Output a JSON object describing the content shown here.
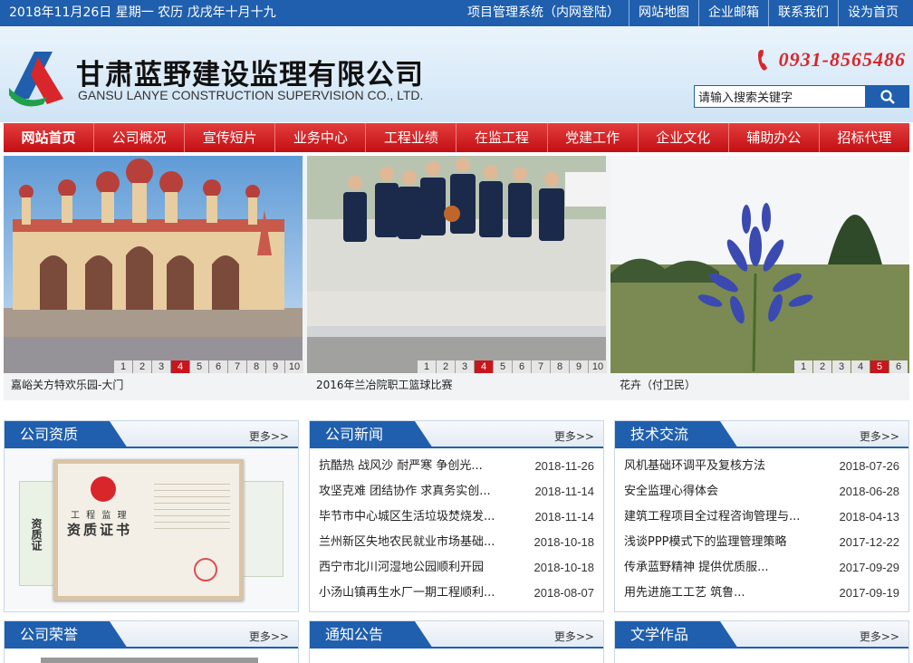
{
  "topbar": {
    "date": "2018年11月26日 星期一 农历 戊戌年十月十九",
    "links": [
      "项目管理系统（内网登陆）",
      "网站地图",
      "企业邮箱",
      "联系我们",
      "设为首页"
    ]
  },
  "header": {
    "company_name": "甘肃蓝野建设监理有限公司",
    "company_name_en": "GANSU LANYE CONSTRUCTION SUPERVISION CO., LTD.",
    "phone": "0931-8565486"
  },
  "search": {
    "placeholder": "请输入搜索关键字",
    "value": "请输入搜索关键字"
  },
  "nav": [
    "网站首页",
    "公司概况",
    "宣传短片",
    "业务中心",
    "工程业绩",
    "在监工程",
    "党建工作",
    "企业文化",
    "辅助办公",
    "招标代理"
  ],
  "slides": [
    {
      "caption": "嘉峪关方特欢乐园-大门",
      "pages": [
        "1",
        "2",
        "3",
        "4",
        "5",
        "6",
        "7",
        "8",
        "9",
        "10"
      ],
      "active": "4"
    },
    {
      "caption": "2016年兰冶院职工篮球比赛",
      "pages": [
        "1",
        "2",
        "3",
        "4",
        "5",
        "6",
        "7",
        "8",
        "9",
        "10"
      ],
      "active": "4"
    },
    {
      "caption": "花卉（付卫民）",
      "pages": [
        "1",
        "2",
        "3",
        "4",
        "5",
        "6"
      ],
      "active": "5"
    }
  ],
  "sections": {
    "qualification": {
      "title": "公司资质",
      "more": "更多>>"
    },
    "news": {
      "title": "公司新闻",
      "more": "更多>>",
      "items": [
        {
          "title": "抗酷热 战风沙 耐严寒 争创光...",
          "date": "2018-11-26"
        },
        {
          "title": "攻坚克难 团结协作 求真务实创...",
          "date": "2018-11-14"
        },
        {
          "title": "毕节市中心城区生活垃圾焚烧发...",
          "date": "2018-11-14"
        },
        {
          "title": "兰州新区失地农民就业市场基础...",
          "date": "2018-10-18"
        },
        {
          "title": "西宁市北川河湿地公园顺利开园",
          "date": "2018-10-18"
        },
        {
          "title": "小汤山镇再生水厂一期工程顺利...",
          "date": "2018-08-07"
        }
      ]
    },
    "tech": {
      "title": "技术交流",
      "more": "更多>>",
      "items": [
        {
          "title": "风机基础环调平及复核方法",
          "date": "2018-07-26"
        },
        {
          "title": "安全监理心得体会",
          "date": "2018-06-28"
        },
        {
          "title": "建筑工程项目全过程咨询管理与...",
          "date": "2018-04-13"
        },
        {
          "title": "浅谈PPP模式下的监理管理策略",
          "date": "2017-12-22"
        },
        {
          "title": "传承蓝野精神 提供优质服...",
          "date": "2017-09-29"
        },
        {
          "title": "用先进施工工艺 筑鲁...",
          "date": "2017-09-19"
        }
      ]
    },
    "honor": {
      "title": "公司荣誉",
      "more": "更多>>"
    },
    "notice": {
      "title": "通知公告",
      "more": "更多>>"
    },
    "literature": {
      "title": "文学作品",
      "more": "更多>>"
    }
  },
  "certificate": {
    "header": "工 程 监 理",
    "title": "资质证书",
    "side_label": "资质证"
  },
  "colors": {
    "brand_blue": "#1f5fae",
    "nav_red": "#c8161d",
    "phone_red": "#d9262b"
  }
}
